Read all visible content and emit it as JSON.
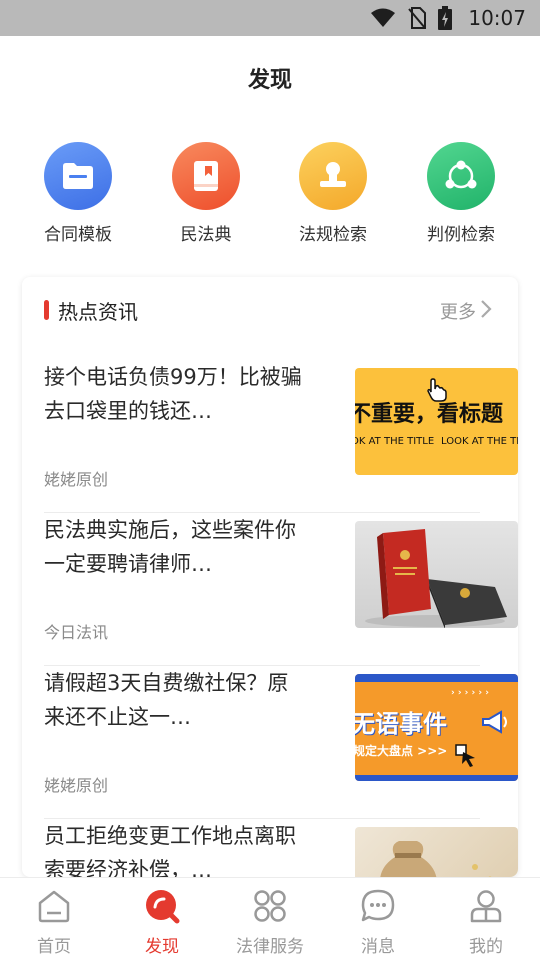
{
  "status_bar": {
    "time": "10:07",
    "icons": [
      "wifi-icon",
      "no-sim-icon",
      "battery-charging-icon"
    ]
  },
  "page": {
    "title": "发现"
  },
  "quick_actions": [
    {
      "label": "合同模板",
      "icon": "folder-icon",
      "color": "#4a80f0"
    },
    {
      "label": "民法典",
      "icon": "book-icon",
      "color": "#f4603a"
    },
    {
      "label": "法规检索",
      "icon": "stamp-icon",
      "color": "#f6b63a"
    },
    {
      "label": "判例检索",
      "icon": "share-nodes-icon",
      "color": "#2fc37a"
    }
  ],
  "news": {
    "header_title": "热点资讯",
    "more_label": "更多",
    "articles": [
      {
        "title": "接个电话负债99万！比被骗去口袋里的钱还…",
        "source": "姥姥原创",
        "thumb": {
          "line1": "不重要，看标题",
          "line2a": "OK AT THE TITLE",
          "line2b": "LOOK AT THE TIT",
          "bg": "#fcc13c"
        }
      },
      {
        "title": "民法典实施后，这些案件你一定要聘请律师…",
        "source": "今日法讯",
        "thumb": {
          "bg": "#dcdcdc"
        }
      },
      {
        "title": "请假超3天自费缴社保？原来还不止这一…",
        "source": "姥姥原创",
        "thumb": {
          "line1": "无语事件",
          "line2": "规定大盘点 >>>",
          "bg": "#f59a2a"
        }
      },
      {
        "title": "员工拒绝变更工作地点离职索要经济补偿，…",
        "source": "",
        "thumb": {
          "bg": "#e9dfcf"
        }
      }
    ]
  },
  "bottom_nav": [
    {
      "label": "首页",
      "icon": "home-icon",
      "active": false
    },
    {
      "label": "发现",
      "icon": "discover-icon",
      "active": true
    },
    {
      "label": "法律服务",
      "icon": "grid-services-icon",
      "active": false
    },
    {
      "label": "消息",
      "icon": "message-icon",
      "active": false
    },
    {
      "label": "我的",
      "icon": "user-icon",
      "active": false
    }
  ],
  "colors": {
    "accent": "#e43a2f",
    "inactive": "#999999"
  }
}
